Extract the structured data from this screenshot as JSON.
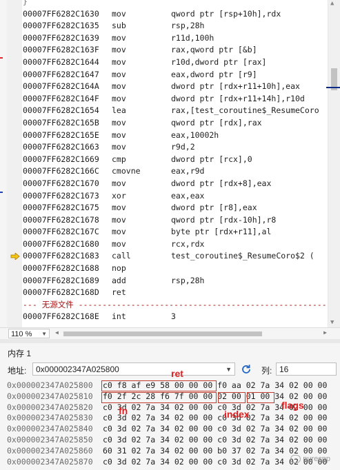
{
  "disassembly": {
    "lines": [
      {
        "addr": "00007FF6282C1630",
        "mnemonic": "mov",
        "operands": "qword ptr [rsp+10h],rdx"
      },
      {
        "addr": "00007FF6282C1635",
        "mnemonic": "sub",
        "operands": "rsp,28h"
      },
      {
        "addr": "00007FF6282C1639",
        "mnemonic": "mov",
        "operands": "r11d,100h"
      },
      {
        "addr": "00007FF6282C163F",
        "mnemonic": "mov",
        "operands": "rax,qword ptr [&b]"
      },
      {
        "addr": "00007FF6282C1644",
        "mnemonic": "mov",
        "operands": "r10d,dword ptr [rax]"
      },
      {
        "addr": "00007FF6282C1647",
        "mnemonic": "mov",
        "operands": "eax,dword ptr [r9]"
      },
      {
        "addr": "00007FF6282C164A",
        "mnemonic": "mov",
        "operands": "dword ptr [rdx+r11+10h],eax"
      },
      {
        "addr": "00007FF6282C164F",
        "mnemonic": "mov",
        "operands": "dword ptr [rdx+r11+14h],r10d"
      },
      {
        "addr": "00007FF6282C1654",
        "mnemonic": "lea",
        "operands": "rax,[test_coroutine$_ResumeCoro"
      },
      {
        "addr": "00007FF6282C165B",
        "mnemonic": "mov",
        "operands": "qword ptr [rdx],rax"
      },
      {
        "addr": "00007FF6282C165E",
        "mnemonic": "mov",
        "operands": "eax,10002h"
      },
      {
        "addr": "00007FF6282C1663",
        "mnemonic": "mov",
        "operands": "r9d,2"
      },
      {
        "addr": "00007FF6282C1669",
        "mnemonic": "cmp",
        "operands": "dword ptr [rcx],0"
      },
      {
        "addr": "00007FF6282C166C",
        "mnemonic": "cmovne",
        "operands": "eax,r9d"
      },
      {
        "addr": "00007FF6282C1670",
        "mnemonic": "mov",
        "operands": "dword ptr [rdx+8],eax"
      },
      {
        "addr": "00007FF6282C1673",
        "mnemonic": "xor",
        "operands": "eax,eax"
      },
      {
        "addr": "00007FF6282C1675",
        "mnemonic": "mov",
        "operands": "dword ptr [r8],eax"
      },
      {
        "addr": "00007FF6282C1678",
        "mnemonic": "mov",
        "operands": "qword ptr [rdx-10h],r8"
      },
      {
        "addr": "00007FF6282C167C",
        "mnemonic": "mov",
        "operands": "byte ptr [rdx+r11],al"
      },
      {
        "addr": "00007FF6282C1680",
        "mnemonic": "mov",
        "operands": "rcx,rdx"
      },
      {
        "addr": "00007FF6282C1683",
        "mnemonic": "call",
        "operands": "test_coroutine$_ResumeCoro$2 ("
      },
      {
        "addr": "00007FF6282C1688",
        "mnemonic": "nop",
        "operands": ""
      },
      {
        "addr": "00007FF6282C1689",
        "mnemonic": "add",
        "operands": "rsp,28h"
      },
      {
        "addr": "00007FF6282C168D",
        "mnemonic": "ret",
        "operands": ""
      }
    ],
    "separator": "--- 无源文件 -----------------------------------------------------------",
    "trailing_line": {
      "addr": "00007FF6282C168E",
      "mnemonic": "int",
      "operands": "3"
    },
    "zoom": "110 %"
  },
  "memory": {
    "tab_title": "内存 1",
    "address_label": "地址:",
    "address_value": "0x000002347A025800",
    "columns_label": "列:",
    "columns_value": "16",
    "rows": [
      {
        "addr": "0x000002347A025800",
        "bytes": "c0 f8 af e9 58 00 00 00 f0 aa 02 7a 34 02 00 00"
      },
      {
        "addr": "0x000002347A025810",
        "bytes": "f0 2f 2c 28 f6 7f 00 00 02 00 01 00 34 02 00 00"
      },
      {
        "addr": "0x000002347A025820",
        "bytes": "c0 3d 02 7a 34 02 00 00 c0 3d 02 7a 34 02 00 00"
      },
      {
        "addr": "0x000002347A025830",
        "bytes": "c0 3d 02 7a 34 02 00 00 c0 3d 02 7a 34 02 00 00"
      },
      {
        "addr": "0x000002347A025840",
        "bytes": "c0 3d 02 7a 34 02 00 00 c0 3d 02 7a 34 02 00 00"
      },
      {
        "addr": "0x000002347A025850",
        "bytes": "c0 3d 02 7a 34 02 00 00 c0 3d 02 7a 34 02 00 00"
      },
      {
        "addr": "0x000002347A025860",
        "bytes": "60 31 02 7a 34 02 00 00 b0 37 02 7a 34 02 00 00"
      },
      {
        "addr": "0x000002347A025870",
        "bytes": "c0 3d 02 7a 34 02 00 00 c0 3d 02 7a 34 02 00 00"
      }
    ],
    "annotations": {
      "ret": "ret",
      "fn": "fn",
      "index": "index",
      "flags": "flags"
    },
    "watermark": "purecpp"
  },
  "colors": {
    "annotation": "#e02020",
    "breakpoint_arrow": "#f5c518",
    "left_marks": [
      "#e8222a",
      "#1f3fbf"
    ]
  },
  "icons": {
    "current_instruction": "yellow-arrow-icon",
    "refresh": "refresh-icon",
    "dropdown": "chevron-down-icon"
  }
}
